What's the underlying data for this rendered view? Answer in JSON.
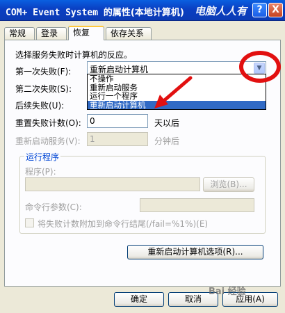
{
  "window": {
    "title_prefix": "COM+ Event System",
    "title_suffix": "的属性(本地计算机)",
    "watermark": "电脑人人有",
    "help_label": "?",
    "close_label": "X"
  },
  "tabs": [
    {
      "label": "常规"
    },
    {
      "label": "登录"
    },
    {
      "label": "恢复"
    },
    {
      "label": "依存关系"
    }
  ],
  "recovery": {
    "intro": "选择服务失败时计算机的反应。",
    "first_failure_label": "第一次失败(F):",
    "first_failure_value": "重新启动计算机",
    "second_failure_label": "第二次失败(S):",
    "subsequent_failure_label": "后续失败(U):",
    "options": [
      "不操作",
      "重新启动服务",
      "运行一个程序",
      "重新启动计算机"
    ],
    "selected_option": "重新启动计算机",
    "reset_count_label": "重置失败计数(O):",
    "reset_count_value": "0",
    "reset_count_unit": "天以后",
    "restart_service_label": "重新启动服务(V):",
    "restart_service_value": "1",
    "restart_service_unit": "分钟后"
  },
  "run_program": {
    "group_title": "运行程序",
    "program_label": "程序(P):",
    "browse_label": "浏览(B)...",
    "cmd_args_label": "命令行参数(C):",
    "append_checkbox_label": "将失败计数附加到命令行结尾(/fail=%1%)(E)"
  },
  "buttons": {
    "restart_options": "重新启动计算机选项(R)...",
    "ok": "确定",
    "cancel": "取消",
    "apply": "应用(A)"
  },
  "footer": {
    "watermark": "Bai 经验"
  },
  "colors": {
    "title_bar": "#0a3fc2",
    "selection": "#316ac5",
    "annotation": "#e21010"
  }
}
